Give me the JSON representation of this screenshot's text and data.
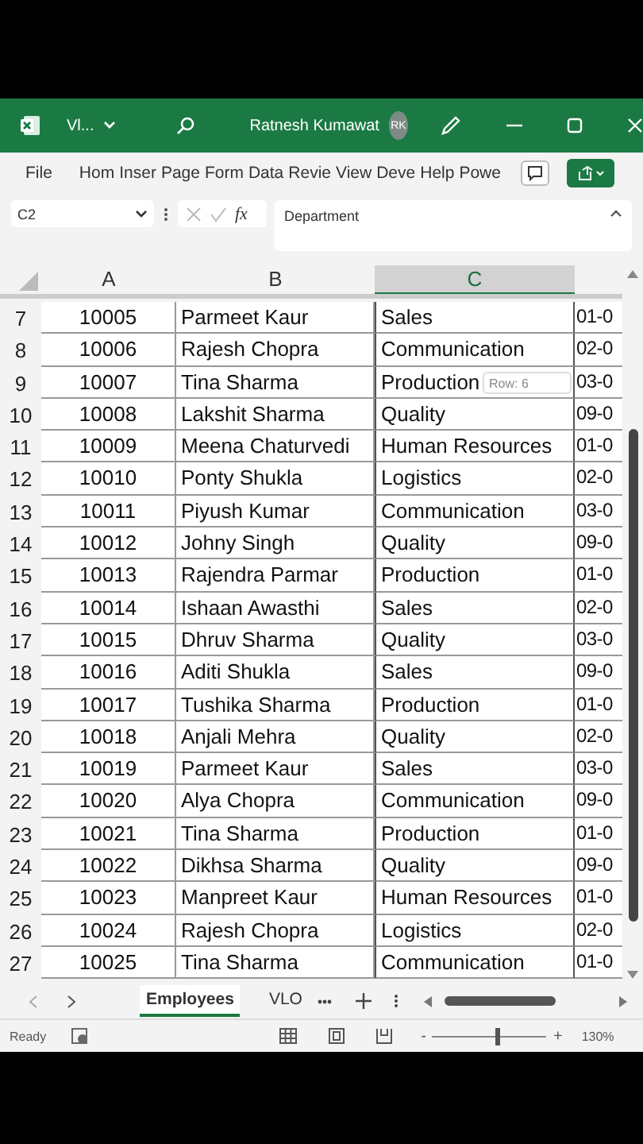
{
  "title_bar": {
    "file_name": "Vl...",
    "user": "Ratnesh Kumawat",
    "initials": "RK"
  },
  "ribbon_tabs": [
    {
      "label": "File"
    },
    {
      "label": "Hom"
    },
    {
      "label": "Inser"
    },
    {
      "label": "Page"
    },
    {
      "label": "Form"
    },
    {
      "label": "Data"
    },
    {
      "label": "Revie"
    },
    {
      "label": "View"
    },
    {
      "label": "Deve"
    },
    {
      "label": "Help"
    },
    {
      "label": "Powe"
    }
  ],
  "formula_bar": {
    "name_box": "C2",
    "function_label": "fx",
    "content": "Department"
  },
  "columns": [
    {
      "label": "A",
      "selected": false
    },
    {
      "label": "B",
      "selected": false
    },
    {
      "label": "C",
      "selected": true
    }
  ],
  "rows": [
    {
      "number": "7",
      "cells": [
        "10005",
        "Parmeet Kaur",
        "Sales",
        "01-0"
      ]
    },
    {
      "number": "8",
      "cells": [
        "10006",
        "Rajesh Chopra",
        "Communication",
        "02-0"
      ]
    },
    {
      "number": "9",
      "cells": [
        "10007",
        "Tina Sharma",
        "Production",
        "03-0"
      ]
    },
    {
      "number": "10",
      "cells": [
        "10008",
        "Lakshit Sharma",
        "Quality",
        "09-0"
      ]
    },
    {
      "number": "11",
      "cells": [
        "10009",
        "Meena Chaturvedi",
        "Human Resources",
        "01-0"
      ]
    },
    {
      "number": "12",
      "cells": [
        "10010",
        "Ponty Shukla",
        "Logistics",
        "02-0"
      ]
    },
    {
      "number": "13",
      "cells": [
        "10011",
        "Piyush Kumar",
        "Communication",
        "03-0"
      ]
    },
    {
      "number": "14",
      "cells": [
        "10012",
        "Johny Singh",
        "Quality",
        "09-0"
      ]
    },
    {
      "number": "15",
      "cells": [
        "10013",
        "Rajendra Parmar",
        "Production",
        "01-0"
      ]
    },
    {
      "number": "16",
      "cells": [
        "10014",
        "Ishaan Awasthi",
        "Sales",
        "02-0"
      ]
    },
    {
      "number": "17",
      "cells": [
        "10015",
        "Dhruv Sharma",
        "Quality",
        "03-0"
      ]
    },
    {
      "number": "18",
      "cells": [
        "10016",
        "Aditi Shukla",
        "Sales",
        "09-0"
      ]
    },
    {
      "number": "19",
      "cells": [
        "10017",
        "Tushika Sharma",
        "Production",
        "01-0"
      ]
    },
    {
      "number": "20",
      "cells": [
        "10018",
        "Anjali Mehra",
        "Quality",
        "02-0"
      ]
    },
    {
      "number": "21",
      "cells": [
        "10019",
        "Parmeet Kaur",
        "Sales",
        "03-0"
      ]
    },
    {
      "number": "22",
      "cells": [
        "10020",
        "Alya Chopra",
        "Communication",
        "09-0"
      ]
    },
    {
      "number": "23",
      "cells": [
        "10021",
        "Tina Sharma",
        "Production",
        "01-0"
      ]
    },
    {
      "number": "24",
      "cells": [
        "10022",
        "Dikhsa Sharma",
        "Quality",
        "09-0"
      ]
    },
    {
      "number": "25",
      "cells": [
        "10023",
        "Manpreet Kaur",
        "Human Resources",
        "01-0"
      ]
    },
    {
      "number": "26",
      "cells": [
        "10024",
        "Rajesh Chopra",
        "Logistics",
        "02-0"
      ]
    },
    {
      "number": "27",
      "cells": [
        "10025",
        "Tina Sharma",
        "Communication",
        "01-0"
      ]
    }
  ],
  "tooltip": "Row: 6",
  "sheet_tabs": [
    {
      "label": "Employees",
      "selected": true
    },
    {
      "label": "VLO",
      "selected": false
    }
  ],
  "status_bar": {
    "status": "Ready",
    "zoom_out": "-",
    "zoom_in": "+",
    "zoom": "130%",
    "level": 0.55
  }
}
